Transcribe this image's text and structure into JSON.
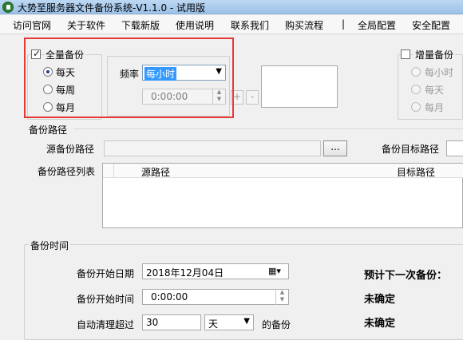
{
  "window": {
    "title": "大势至服务器文件备份系统-V1.1.0 - 试用版"
  },
  "menu": [
    "访问官网",
    "关于软件",
    "下载新版",
    "使用说明",
    "联系我们",
    "购买流程",
    "|",
    "全局配置",
    "安全配置"
  ],
  "full_backup": {
    "label": "全量备份",
    "options": [
      "每天",
      "每周",
      "每月"
    ],
    "selected": "每天",
    "frequency_label": "频率",
    "frequency_value": "每小时",
    "time_value": "0:00:00",
    "plus": "+",
    "minus": "-"
  },
  "incremental_backup": {
    "label": "增量备份",
    "options": [
      "每小时",
      "每天",
      "每月"
    ]
  },
  "backup_path": {
    "section_label": "备份路径",
    "source_label": "源备份路径",
    "browse_label": "...",
    "target_label": "备份目标路径",
    "list_label": "备份路径列表",
    "columns": [
      "源路径",
      "目标路径"
    ]
  },
  "backup_time": {
    "section_label": "备份时间",
    "start_date_label": "备份开始日期",
    "start_date_value": "2018年12月04日",
    "start_time_label": "备份开始时间",
    "start_time_value": "0:00:00",
    "cleanup_label": "自动清理超过",
    "cleanup_value": "30",
    "cleanup_unit": "天",
    "cleanup_suffix": "的备份",
    "next_backup_label": "预计下一次备份：",
    "next_backup_value": "未确定",
    "next_backup_value2": "未确定"
  }
}
